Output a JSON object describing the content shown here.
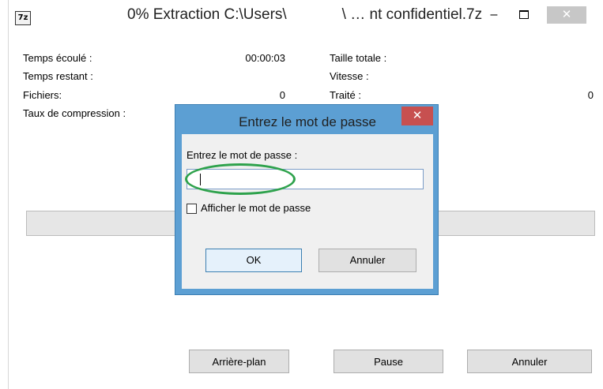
{
  "window": {
    "title_prefix": "0% Extraction C:\\Users\\",
    "title_suffix": "\\ … nt confidentiel.7z",
    "app_icon_text": "7z",
    "min_label": "–",
    "close_label": "✕"
  },
  "stats": {
    "elapsed_label": "Temps écoulé :",
    "elapsed_value": "00:00:03",
    "remaining_label": "Temps restant :",
    "files_label": "Fichiers:",
    "files_value": "0",
    "ratio_label": "Taux de compression :",
    "total_size_label": "Taille totale :",
    "speed_label": "Vitesse :",
    "processed_label": "Traité :",
    "processed_value": "0"
  },
  "progress": {
    "fraction": 0
  },
  "buttons": {
    "background": "Arrière-plan",
    "pause": "Pause",
    "cancel": "Annuler"
  },
  "dialog": {
    "title": "Entrez le mot de passe",
    "close_label": "✕",
    "prompt": "Entrez le mot de passe :",
    "password_value": "",
    "show_password_label": "Afficher le mot de passe",
    "show_password_checked": false,
    "ok": "OK",
    "cancel": "Annuler"
  },
  "colors": {
    "dialog_frame": "#5c9fd3",
    "dialog_close": "#c75050",
    "highlight": "#2ea24c"
  }
}
